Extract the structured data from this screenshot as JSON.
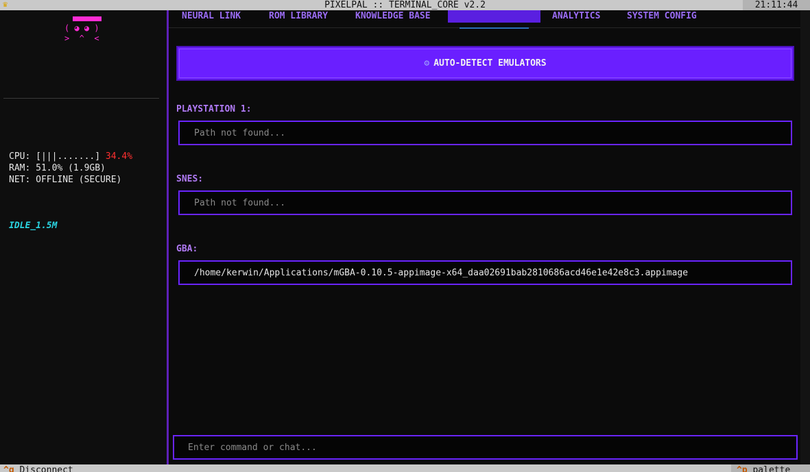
{
  "titlebar": {
    "crown_icon": "crown-icon",
    "title": "PIXELPAL :: TERMINAL_CORE v2.2",
    "clock": "21:11:44"
  },
  "sidebar": {
    "mascot": {
      "face": "( ◕ ◕ )",
      "mouth": ">  ^  <"
    },
    "stats": {
      "cpu_label": "CPU: [|||.......] ",
      "cpu_value": "34.4%",
      "ram": "RAM: 51.0% (1.9GB)",
      "net": "NET: OFFLINE (SECURE)"
    },
    "status": "IDLE_1.5M"
  },
  "tabs": [
    {
      "label": "NEURAL LINK"
    },
    {
      "label": "ROM LIBRARY"
    },
    {
      "label": "KNOWLEDGE BASE"
    },
    {
      "label": ""
    },
    {
      "label": "ANALYTICS"
    },
    {
      "label": "SYSTEM CONFIG"
    }
  ],
  "main": {
    "detect_button": {
      "icon": "gear-icon",
      "label": "AUTO-DETECT EMULATORS"
    },
    "emulators": [
      {
        "label": "PLAYSTATION 1:",
        "value": "",
        "placeholder": "Path not found..."
      },
      {
        "label": "SNES:",
        "value": "",
        "placeholder": "Path not found..."
      },
      {
        "label": "GBA:",
        "value": "/home/kerwin/Applications/mGBA-0.10.5-appimage-x64_daa02691bab2810686acd46e1e42e8c3.appimage",
        "placeholder": ""
      }
    ],
    "command_input": {
      "placeholder": "Enter command or chat..."
    }
  },
  "footer": {
    "left_key": "^q",
    "left_label": " Disconnect",
    "right_key": "^p",
    "right_label": " palette"
  },
  "colors": {
    "accent": "#6a1fff",
    "tab_text": "#9a6cf5",
    "mascot": "#ff2cd4",
    "idle": "#2ad3e0",
    "cpu_warn": "#ff3030"
  }
}
